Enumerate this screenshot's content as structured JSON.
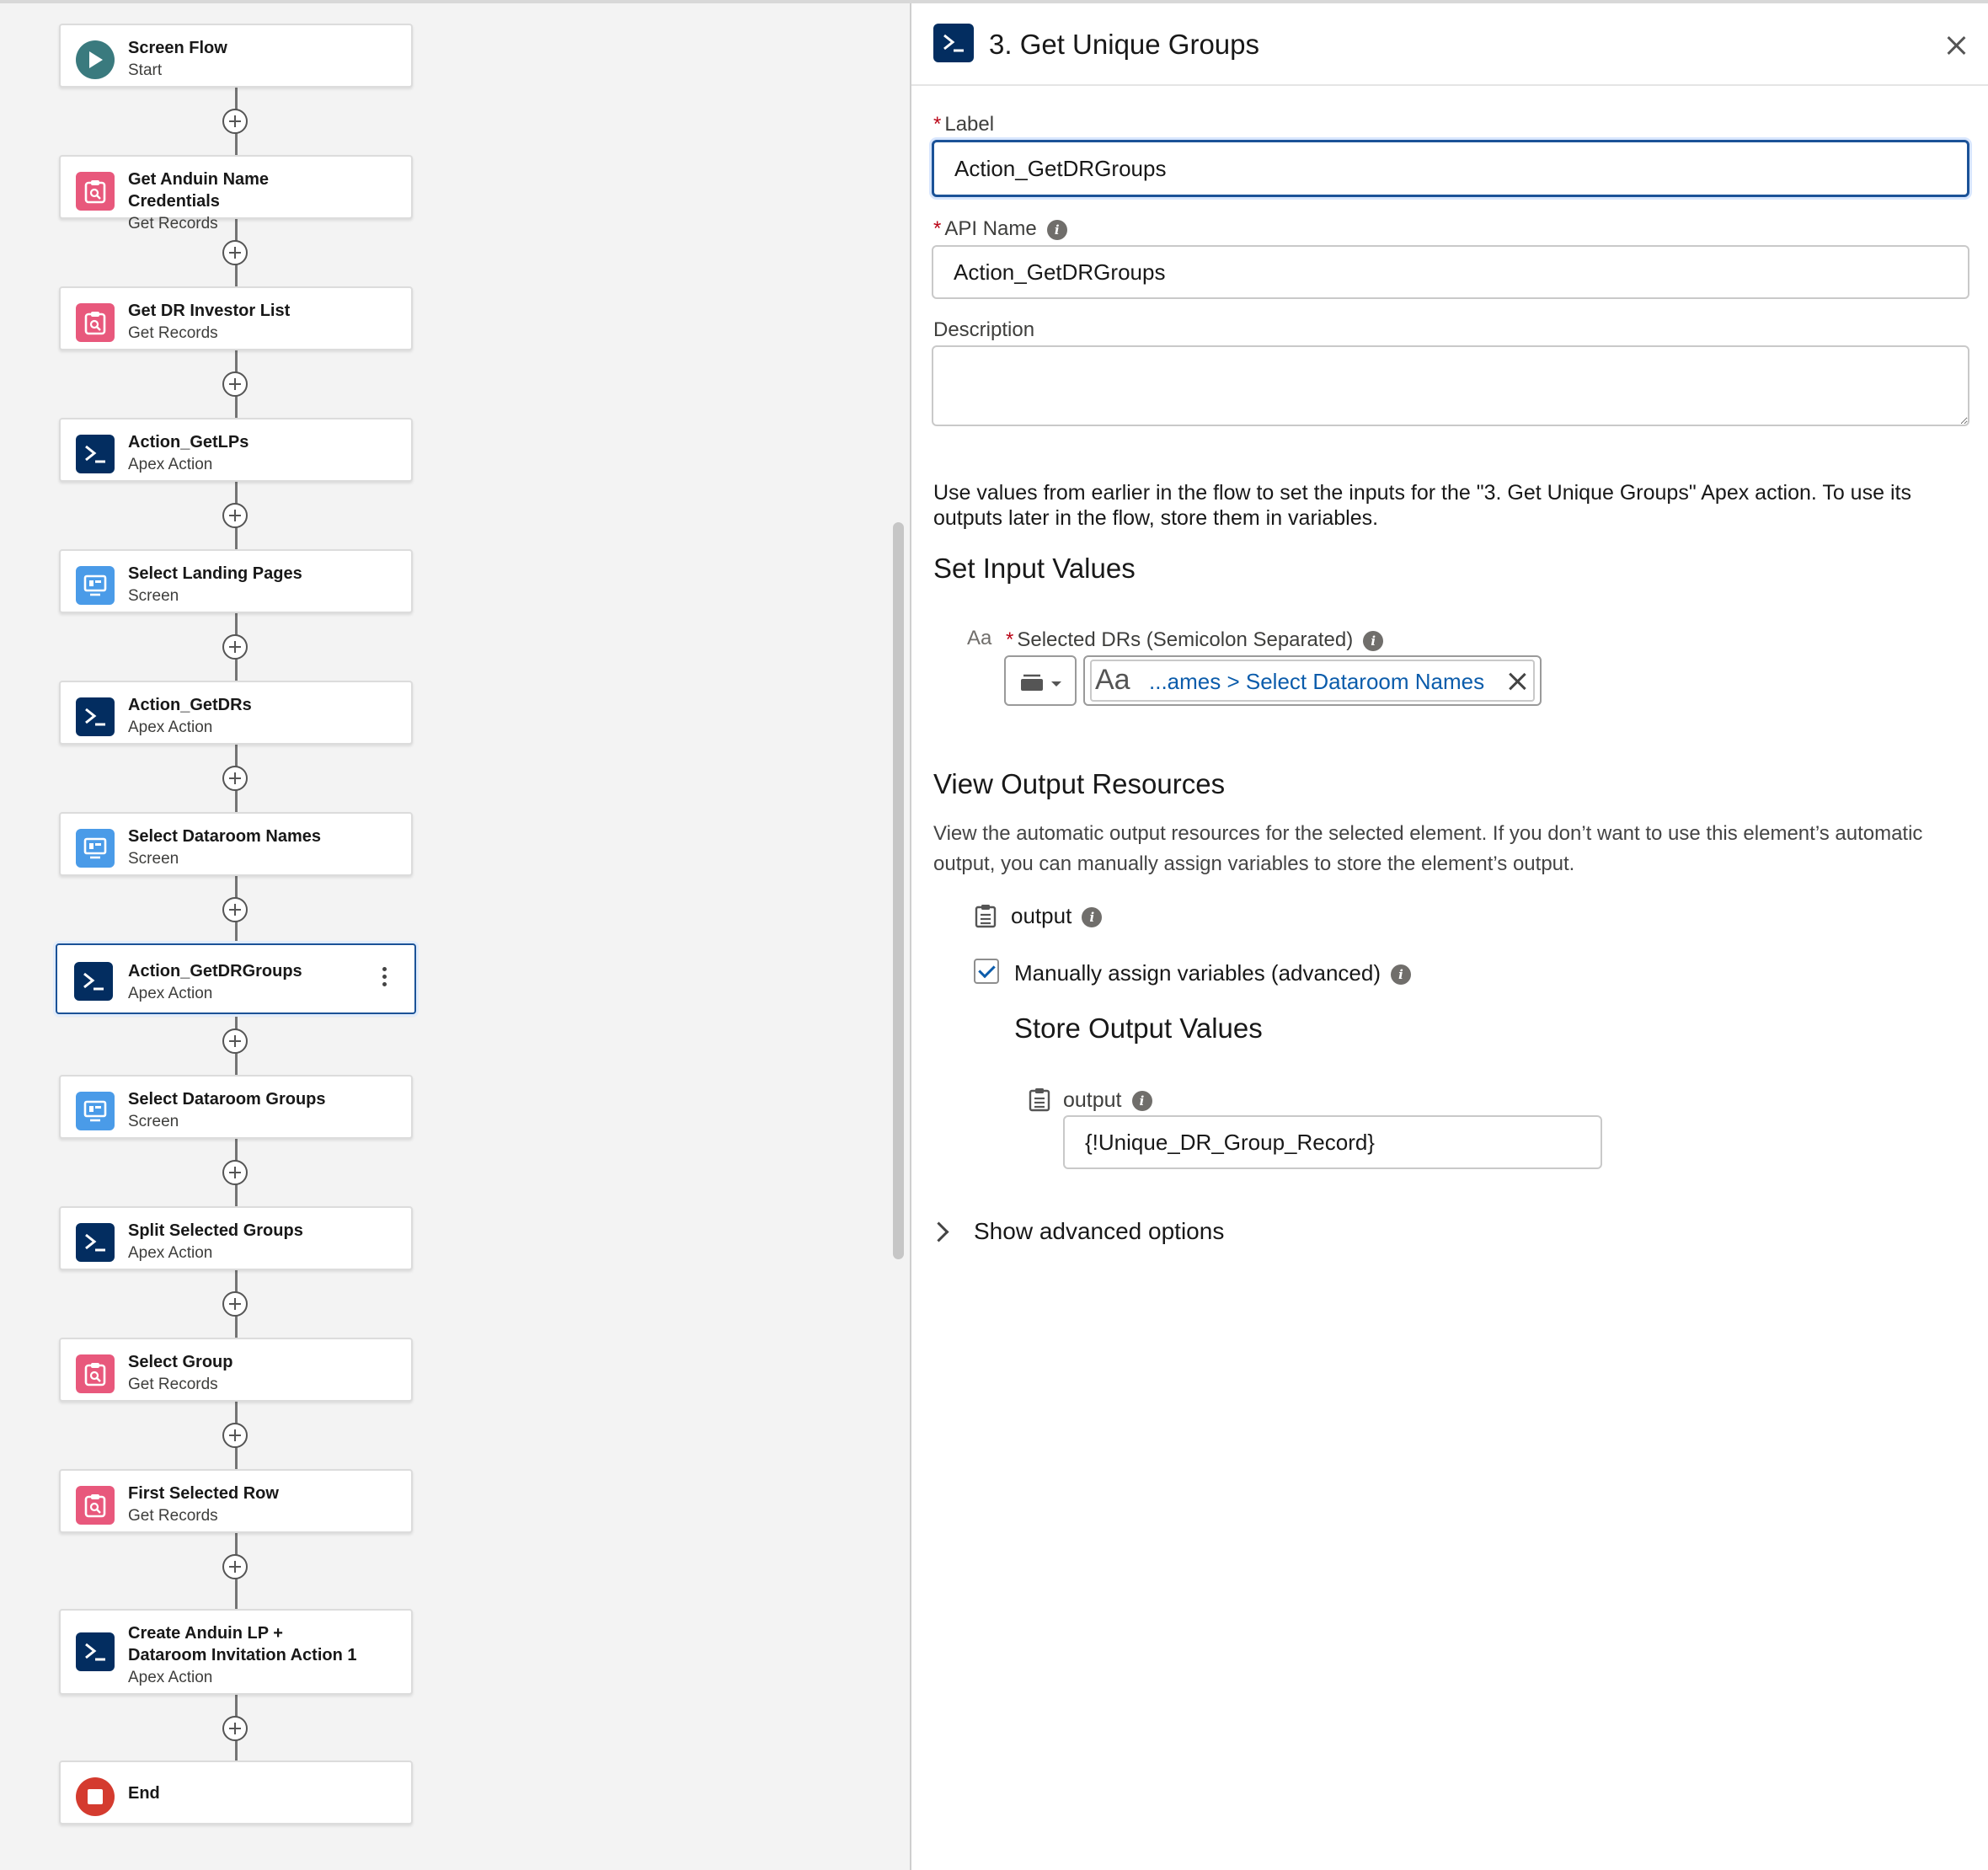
{
  "flow": {
    "nodes": [
      {
        "title": "Screen Flow",
        "subtitle": "Start",
        "type": "start"
      },
      {
        "title": "Get Anduin Name Credentials",
        "subtitle": "Get Records",
        "type": "get"
      },
      {
        "title": "Get DR Investor List",
        "subtitle": "Get Records",
        "type": "get"
      },
      {
        "title": "Action_GetLPs",
        "subtitle": "Apex Action",
        "type": "apex"
      },
      {
        "title": "Select Landing Pages",
        "subtitle": "Screen",
        "type": "screen"
      },
      {
        "title": "Action_GetDRs",
        "subtitle": "Apex Action",
        "type": "apex"
      },
      {
        "title": "Select Dataroom Names",
        "subtitle": "Screen",
        "type": "screen"
      },
      {
        "title": "Action_GetDRGroups",
        "subtitle": "Apex Action",
        "type": "apex",
        "selected": true
      },
      {
        "title": "Select Dataroom Groups",
        "subtitle": "Screen",
        "type": "screen"
      },
      {
        "title": "Split Selected Groups",
        "subtitle": "Apex Action",
        "type": "apex"
      },
      {
        "title": "Select Group",
        "subtitle": "Get Records",
        "type": "get"
      },
      {
        "title": "First Selected Row",
        "subtitle": "Get Records",
        "type": "get"
      },
      {
        "title": "Create Anduin LP + Dataroom Invitation Action 1",
        "subtitle": "Apex Action",
        "type": "apex"
      },
      {
        "title": "End",
        "subtitle": "",
        "type": "end"
      }
    ]
  },
  "panel": {
    "title": "3. Get Unique Groups",
    "label_field": {
      "label": "Label",
      "value": "Action_GetDRGroups"
    },
    "api_name_field": {
      "label": "API Name",
      "value": "Action_GetDRGroups"
    },
    "description_field": {
      "label": "Description",
      "value": ""
    },
    "intro_text": "Use values from earlier in the flow to set the inputs for the \"3. Get Unique Groups\" Apex action. To use its outputs later in the flow, store them in variables.",
    "set_input_heading": "Set Input Values",
    "input_param": {
      "type_glyph": "Aa",
      "label": "Selected DRs (Semicolon Separated)",
      "pill_glyph": "Aa",
      "pill_value": "...ames > Select Dataroom Names"
    },
    "view_output_heading": "View Output Resources",
    "view_output_text": "View the automatic output resources for the selected element. If you don’t want to use this element’s automatic output, you can manually assign variables to store the element’s output.",
    "output_resource_label": "output",
    "manual_assign_label": "Manually assign variables (advanced)",
    "manual_assign_checked": true,
    "store_output_heading": "Store Output Values",
    "store_output": {
      "label": "output",
      "value": "{!Unique_DR_Group_Record}"
    },
    "advanced_options_label": "Show advanced options"
  },
  "colors": {
    "selected_border": "#1b5297",
    "apex_icon": "#032d60",
    "get_records_icon": "#e8587c",
    "screen_icon": "#4a9be8",
    "start_icon": "#3a7a7e",
    "end_icon": "#d43b2f",
    "link_text": "#0b5cab",
    "required_asterisk": "#ba0517"
  },
  "icons": {
    "start": "play-icon",
    "get": "get-records-icon",
    "apex": "apex-action-icon",
    "screen": "screen-icon",
    "end": "stop-icon",
    "kebab": "kebab-menu-icon",
    "add": "add-element-icon",
    "close": "close-icon",
    "info": "info-icon",
    "output": "clipboard-icon",
    "chevron": "chevron-right-icon"
  }
}
